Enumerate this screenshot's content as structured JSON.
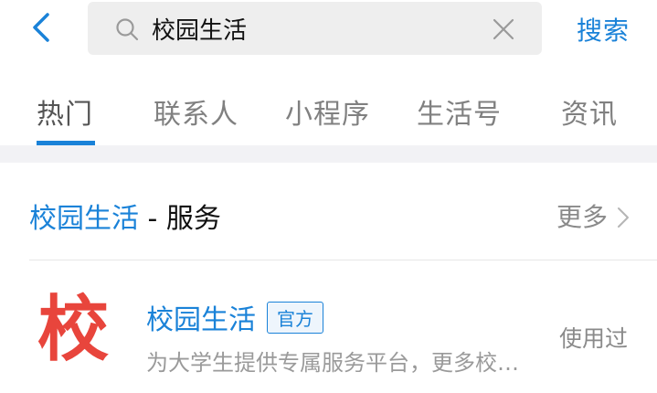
{
  "search": {
    "query": "校园生活",
    "submit_label": "搜索"
  },
  "tabs": [
    {
      "label": "热门",
      "active": true
    },
    {
      "label": "联系人",
      "active": false
    },
    {
      "label": "小程序",
      "active": false
    },
    {
      "label": "生活号",
      "active": false
    },
    {
      "label": "资讯",
      "active": false
    }
  ],
  "section": {
    "title_keyword": "校园生活",
    "title_suffix": " - 服务",
    "more_label": "更多"
  },
  "result": {
    "logo_char": "校",
    "title": "校园生活",
    "badge": "官方",
    "description": "为大学生提供专属服务平台，更多校园服务等你来体验",
    "status": "使用过"
  },
  "colors": {
    "accent": "#1a82d8",
    "logo": "#e8453c"
  }
}
